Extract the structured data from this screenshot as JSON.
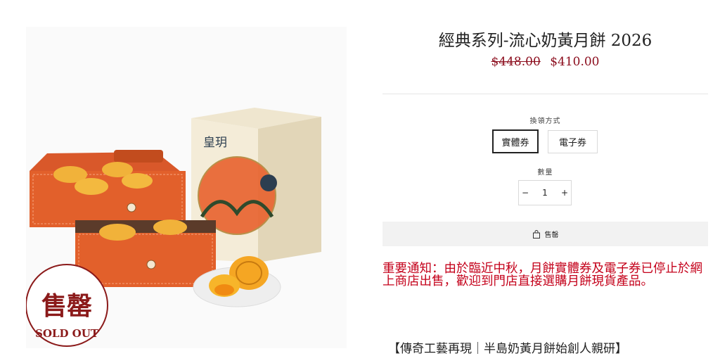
{
  "product": {
    "title": "經典系列-流心奶黃月餅 2026",
    "price_original": "$448.00",
    "price_sale": "$410.00",
    "image_alt": "經典系列-流心奶黃月餅 禮盒",
    "sold_out_badge": {
      "chinese": "售罄",
      "english": "SOLD OUT"
    },
    "box_brand": "皇玥"
  },
  "redemption": {
    "label": "換領方式",
    "options": [
      "實體券",
      "電子券"
    ],
    "selected": "實體券"
  },
  "quantity": {
    "label": "數量",
    "minus": "−",
    "plus": "+",
    "value": "1"
  },
  "sold_out_button": {
    "label": "售罄",
    "icon": "shopping-bag-icon"
  },
  "notice": "重要通知：由於臨近中秋，月餅實體券及電子券已停止於網上商店出售，歡迎到門店直接選購月餅現貨產品。",
  "description_heading": "【傳奇工藝再現｜半島奶黃月餅始創人親研】",
  "colors": {
    "price": "#8b0c1c",
    "notice": "#c4001a",
    "badge": "#8b1a1a",
    "box_orange": "#e2602b"
  }
}
